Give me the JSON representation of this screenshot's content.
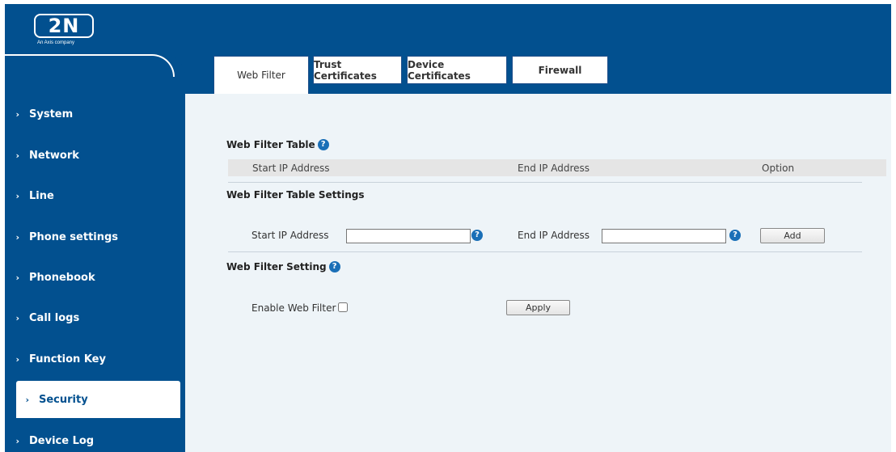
{
  "brand": {
    "logo_text": "2N",
    "logo_subtitle": "An Axis company",
    "header_color": "#02508f"
  },
  "tabs": [
    {
      "label": "Web Filter",
      "active": true
    },
    {
      "label": "Trust Certificates",
      "active": false
    },
    {
      "label": "Device Certificates",
      "active": false
    },
    {
      "label": "Firewall",
      "active": false
    }
  ],
  "sidebar": {
    "items": [
      {
        "label": "System",
        "icon": "chevron-right-icon"
      },
      {
        "label": "Network",
        "icon": "chevron-right-icon"
      },
      {
        "label": "Line",
        "icon": "chevron-right-icon"
      },
      {
        "label": "Phone settings",
        "icon": "chevron-right-icon"
      },
      {
        "label": "Phonebook",
        "icon": "chevron-right-icon"
      },
      {
        "label": "Call logs",
        "icon": "chevron-right-icon"
      },
      {
        "label": "Function Key",
        "icon": "chevron-right-icon"
      },
      {
        "label": "Security",
        "icon": "chevron-right-icon",
        "active": true
      },
      {
        "label": "Device Log",
        "icon": "chevron-right-icon"
      }
    ],
    "chevron": "›"
  },
  "web_filter_table": {
    "title": "Web Filter Table",
    "columns": [
      "Start IP Address",
      "End IP Address",
      "Option"
    ]
  },
  "table_settings": {
    "title": "Web Filter Table Settings",
    "start_label": "Start IP Address",
    "start_value": "",
    "end_label": "End IP Address",
    "end_value": "",
    "add_label": "Add"
  },
  "filter_setting": {
    "title": "Web Filter Setting",
    "enable_label": "Enable Web Filter",
    "enabled": false,
    "apply_label": "Apply"
  },
  "help_glyph": "?"
}
